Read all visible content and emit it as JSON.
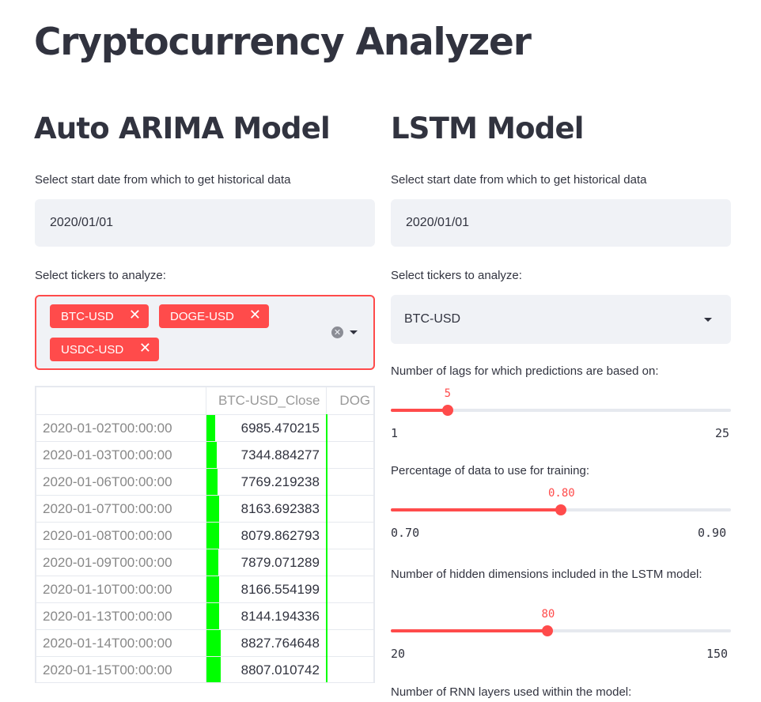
{
  "page": {
    "title": "Cryptocurrency Analyzer"
  },
  "arima": {
    "heading": "Auto ARIMA Model",
    "date_label": "Select start date from which to get historical data",
    "date_value": "2020/01/01",
    "tickers_label": "Select tickers to analyze:",
    "tickers": [
      "BTC-USD",
      "DOGE-USD",
      "USDC-USD"
    ],
    "table": {
      "columns": [
        "",
        "BTC-USD_Close",
        "DOG"
      ],
      "rows": [
        {
          "index": "2020-01-02T00:00:00",
          "value": "6985.470215",
          "bar": 0.02
        },
        {
          "index": "2020-01-03T00:00:00",
          "value": "7344.884277",
          "bar": 0.04
        },
        {
          "index": "2020-01-06T00:00:00",
          "value": "7769.219238",
          "bar": 0.07
        },
        {
          "index": "2020-01-07T00:00:00",
          "value": "8163.692383",
          "bar": 0.09
        },
        {
          "index": "2020-01-08T00:00:00",
          "value": "8079.862793",
          "bar": 0.09
        },
        {
          "index": "2020-01-09T00:00:00",
          "value": "7879.071289",
          "bar": 0.08
        },
        {
          "index": "2020-01-10T00:00:00",
          "value": "8166.554199",
          "bar": 0.09
        },
        {
          "index": "2020-01-13T00:00:00",
          "value": "8144.194336",
          "bar": 0.09
        },
        {
          "index": "2020-01-14T00:00:00",
          "value": "8827.764648",
          "bar": 0.13
        },
        {
          "index": "2020-01-15T00:00:00",
          "value": "8807.010742",
          "bar": 0.13
        }
      ]
    }
  },
  "lstm": {
    "heading": "LSTM Model",
    "date_label": "Select start date from which to get historical data",
    "date_value": "2020/01/01",
    "tickers_label": "Select tickers to analyze:",
    "ticker_selected": "BTC-USD",
    "sliders": [
      {
        "label": "Number of lags for which predictions are based on:",
        "value": "5",
        "min": "1",
        "max": "25",
        "fraction": 0.1667
      },
      {
        "label": "Percentage of data to use for training:",
        "value": "0.80",
        "min": "0.70",
        "max": "0.90",
        "fraction": 0.5
      },
      {
        "label": "Number of hidden dimensions included in the LSTM model:",
        "value": "80",
        "min": "20",
        "max": "150",
        "fraction": 0.4615
      }
    ],
    "rnn_label": "Number of RNN layers used within the model:"
  },
  "colors": {
    "accent": "#ff4b4b",
    "bar": "#00ff00",
    "input_bg": "#f0f2f6"
  },
  "icons": [
    "close-icon",
    "clear-all-icon",
    "chevron-down-icon"
  ]
}
